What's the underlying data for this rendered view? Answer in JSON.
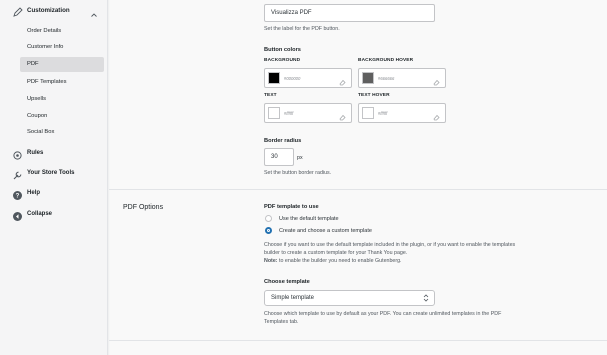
{
  "sidebar": {
    "section": {
      "label": "Customization",
      "icon": "brush-icon"
    },
    "subitems": [
      {
        "label": "Order Details"
      },
      {
        "label": "Customer Info"
      },
      {
        "label": "PDF",
        "active": true
      },
      {
        "label": "PDF Templates"
      },
      {
        "label": "Upsells"
      },
      {
        "label": "Coupon"
      },
      {
        "label": "Social Box"
      }
    ],
    "main_items": [
      {
        "label": "Rules",
        "icon": "gear-icon"
      },
      {
        "label": "Your Store Tools",
        "icon": "wrench-icon"
      },
      {
        "label": "Help",
        "icon": "help-icon"
      },
      {
        "label": "Collapse",
        "icon": "collapse-icon"
      }
    ]
  },
  "button_settings": {
    "label_value": "Visualizza PDF",
    "label_help": "Set the label for the PDF button.",
    "colors_title": "Button colors",
    "background": {
      "label": "BACKGROUND",
      "hex": "#000000",
      "swatch": "#000000"
    },
    "background_hover": {
      "label": "BACKGROUND HOVER",
      "hex": "#666666",
      "swatch": "#5f5f5f"
    },
    "text": {
      "label": "TEXT",
      "hex": "#ffffff",
      "swatch": "#ffffff"
    },
    "text_hover": {
      "label": "TEXT HOVER",
      "hex": "#ffffff",
      "swatch": "#ffffff"
    },
    "border_radius_title": "Border radius",
    "border_radius_value": "30",
    "border_radius_unit": "px",
    "border_radius_help": "Set the button border radius."
  },
  "pdf_options": {
    "title": "PDF Options",
    "template_label": "PDF template to use",
    "options": [
      {
        "label": "Use the default template",
        "selected": false
      },
      {
        "label": "Create and choose a custom template",
        "selected": true
      }
    ],
    "help_line1": "Choose if you want to use the default template included in the plugin, or if you want to enable the templates",
    "help_line2": "builder to create a custom template for your Thank You page.",
    "note_bold": "Note:",
    "note_text": " to enable the builder you need to enable Gutenberg.",
    "choose_label": "Choose template",
    "choose_value": "Simple template",
    "choose_help1": "Choose which template to use by default as your PDF. You can create unlimited templates in the PDF",
    "choose_help2": "Templates tab."
  },
  "colors": {
    "accent": "#2271b1"
  }
}
